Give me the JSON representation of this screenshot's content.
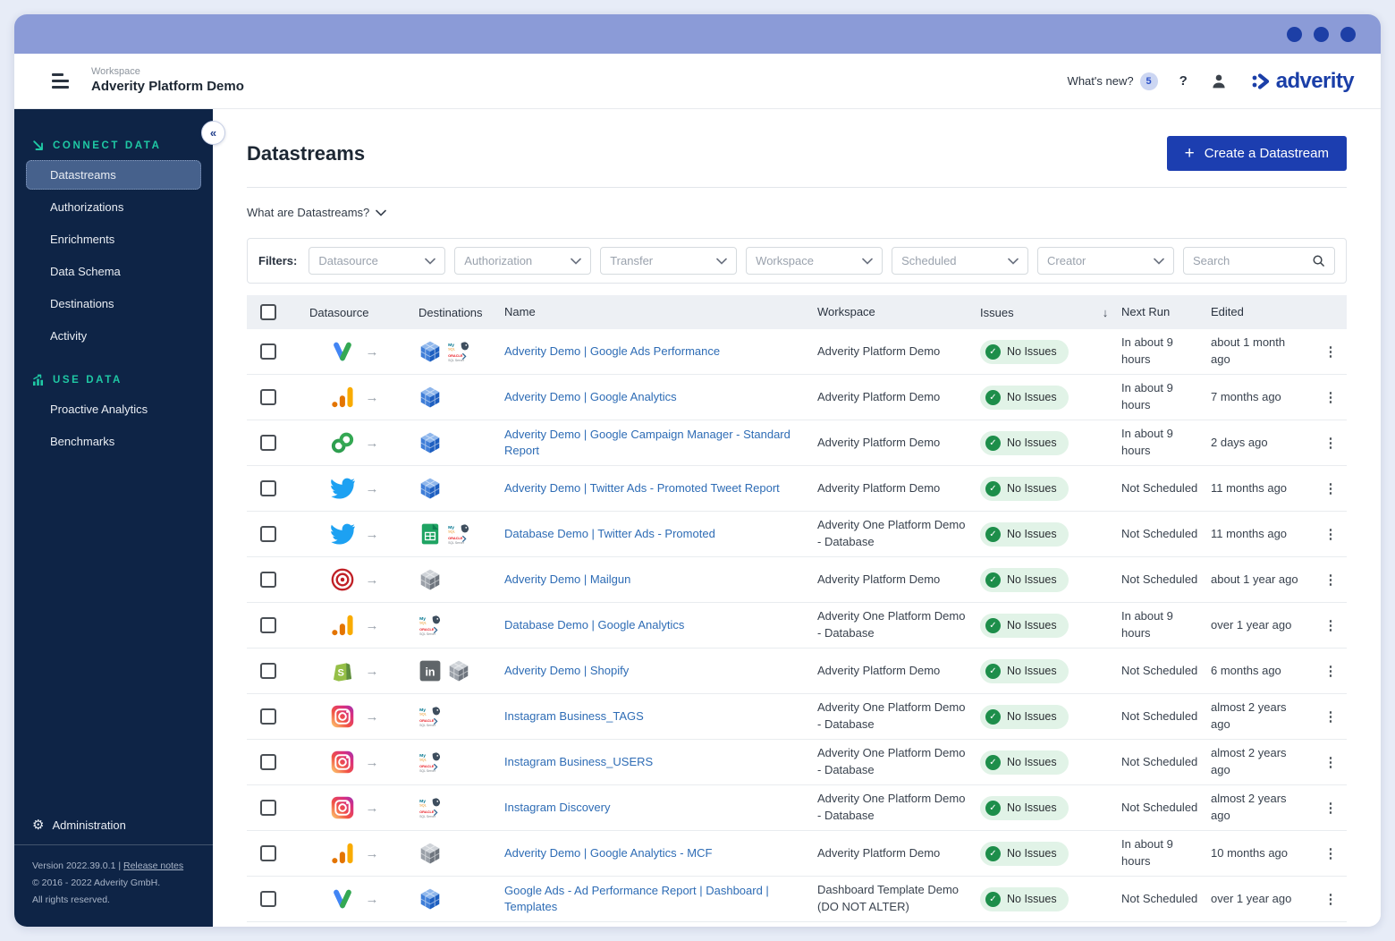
{
  "colors": {
    "brand_blue": "#1b3fa8",
    "button_blue": "#1c3eb0",
    "titlebar_purple": "#8b9bd7",
    "sidebar_navy": "#0e2446",
    "section_teal": "#1fc8a4",
    "success_green": "#1d8e4a",
    "success_bg": "#e1f3e7",
    "link_blue": "#2e6cb5"
  },
  "header": {
    "workspace_label": "Workspace",
    "workspace_name": "Adverity Platform Demo",
    "whats_new_label": "What's new?",
    "whats_new_count": "5",
    "help_label": "?",
    "logo_text": "adverity",
    "icons": [
      "hamburger-icon",
      "question-icon",
      "user-icon",
      "adverity-logo-mark"
    ]
  },
  "sidebar": {
    "collapse_label": "«",
    "sections": [
      {
        "label": "CONNECT DATA",
        "icon": "connect-data-icon",
        "items": [
          {
            "label": "Datastreams",
            "active": true
          },
          {
            "label": "Authorizations",
            "active": false
          },
          {
            "label": "Enrichments",
            "active": false
          },
          {
            "label": "Data Schema",
            "active": false
          },
          {
            "label": "Destinations",
            "active": false
          },
          {
            "label": "Activity",
            "active": false
          }
        ]
      },
      {
        "label": "USE DATA",
        "icon": "use-data-icon",
        "items": [
          {
            "label": "Proactive Analytics",
            "active": false
          },
          {
            "label": "Benchmarks",
            "active": false
          }
        ]
      }
    ],
    "admin": {
      "label": "Administration",
      "icon": "gear-icon"
    },
    "footer": {
      "version_text": "Version 2022.39.0.1 |",
      "release_notes_label": "Release notes",
      "copyright": "© 2016 - 2022 Adverity GmbH.",
      "rights": "All rights reserved."
    }
  },
  "main": {
    "title": "Datastreams",
    "create_button_label": "Create a Datastream",
    "create_button_plus": "+",
    "what_are_label": "What are Datastreams?",
    "filters_label": "Filters:",
    "filters": [
      "Datasource",
      "Authorization",
      "Transfer",
      "Workspace",
      "Scheduled",
      "Creator"
    ],
    "search_placeholder": "Search",
    "table": {
      "columns": {
        "datasource": "Datasource",
        "destinations": "Destinations",
        "name": "Name",
        "workspace": "Workspace",
        "issues": "Issues",
        "sort_indicator": "↓",
        "next_run": "Next Run",
        "edited": "Edited"
      },
      "rows": [
        {
          "datasource_icon": "google-ads-icon",
          "destination_icons": [
            "blue-cube-icon",
            "db-cluster-icon"
          ],
          "name": "Adverity Demo | Google Ads Performance",
          "workspace": "Adverity Platform Demo",
          "issues": "No Issues",
          "next_run": "In about 9 hours",
          "edited": "about 1 month ago"
        },
        {
          "datasource_icon": "google-analytics-icon",
          "destination_icons": [
            "blue-cube-icon"
          ],
          "name": "Adverity Demo | Google Analytics",
          "workspace": "Adverity Platform Demo",
          "issues": "No Issues",
          "next_run": "In about 9 hours",
          "edited": "7 months ago"
        },
        {
          "datasource_icon": "campaign-manager-icon",
          "destination_icons": [
            "blue-cube-icon"
          ],
          "name": "Adverity Demo | Google Campaign Manager - Standard Report",
          "workspace": "Adverity Platform Demo",
          "issues": "No Issues",
          "next_run": "In about 9 hours",
          "edited": "2 days ago"
        },
        {
          "datasource_icon": "twitter-icon",
          "destination_icons": [
            "blue-cube-icon"
          ],
          "name": "Adverity Demo | Twitter Ads - Promoted Tweet Report",
          "workspace": "Adverity Platform Demo",
          "issues": "No Issues",
          "next_run": "Not Scheduled",
          "edited": "11 months ago"
        },
        {
          "datasource_icon": "twitter-icon",
          "destination_icons": [
            "sheets-icon",
            "db-cluster-icon"
          ],
          "name": "Database Demo | Twitter Ads - Promoted",
          "workspace": "Adverity One Platform Demo - Database",
          "issues": "No Issues",
          "next_run": "Not Scheduled",
          "edited": "11 months ago"
        },
        {
          "datasource_icon": "mailgun-icon",
          "destination_icons": [
            "gray-cube-icon"
          ],
          "name": "Adverity Demo | Mailgun",
          "workspace": "Adverity Platform Demo",
          "issues": "No Issues",
          "next_run": "Not Scheduled",
          "edited": "about 1 year ago"
        },
        {
          "datasource_icon": "google-analytics-icon",
          "destination_icons": [
            "db-cluster-icon"
          ],
          "name": "Database Demo | Google Analytics",
          "workspace": "Adverity One Platform Demo - Database",
          "issues": "No Issues",
          "next_run": "In about 9 hours",
          "edited": "over 1 year ago"
        },
        {
          "datasource_icon": "shopify-icon",
          "destination_icons": [
            "linkedin-icon",
            "gray-cube-icon"
          ],
          "name": "Adverity Demo | Shopify",
          "workspace": "Adverity Platform Demo",
          "issues": "No Issues",
          "next_run": "Not Scheduled",
          "edited": "6 months ago"
        },
        {
          "datasource_icon": "instagram-icon",
          "destination_icons": [
            "db-cluster-icon"
          ],
          "name": "Instagram Business_TAGS",
          "workspace": "Adverity One Platform Demo - Database",
          "issues": "No Issues",
          "next_run": "Not Scheduled",
          "edited": "almost 2 years ago"
        },
        {
          "datasource_icon": "instagram-icon",
          "destination_icons": [
            "db-cluster-icon"
          ],
          "name": "Instagram Business_USERS",
          "workspace": "Adverity One Platform Demo - Database",
          "issues": "No Issues",
          "next_run": "Not Scheduled",
          "edited": "almost 2 years ago"
        },
        {
          "datasource_icon": "instagram-icon",
          "destination_icons": [
            "db-cluster-icon"
          ],
          "name": "Instagram Discovery",
          "workspace": "Adverity One Platform Demo - Database",
          "issues": "No Issues",
          "next_run": "Not Scheduled",
          "edited": "almost 2 years ago"
        },
        {
          "datasource_icon": "google-analytics-icon",
          "destination_icons": [
            "gray-cube-icon"
          ],
          "name": "Adverity Demo | Google Analytics - MCF",
          "workspace": "Adverity Platform Demo",
          "issues": "No Issues",
          "next_run": "In about 9 hours",
          "edited": "10 months ago"
        },
        {
          "datasource_icon": "google-ads-icon",
          "destination_icons": [
            "blue-cube-icon"
          ],
          "name": "Google Ads - Ad Performance Report | Dashboard | Templates",
          "workspace": "Dashboard Template Demo (DO NOT ALTER)",
          "issues": "No Issues",
          "next_run": "Not Scheduled",
          "edited": "over 1 year ago"
        }
      ]
    }
  }
}
